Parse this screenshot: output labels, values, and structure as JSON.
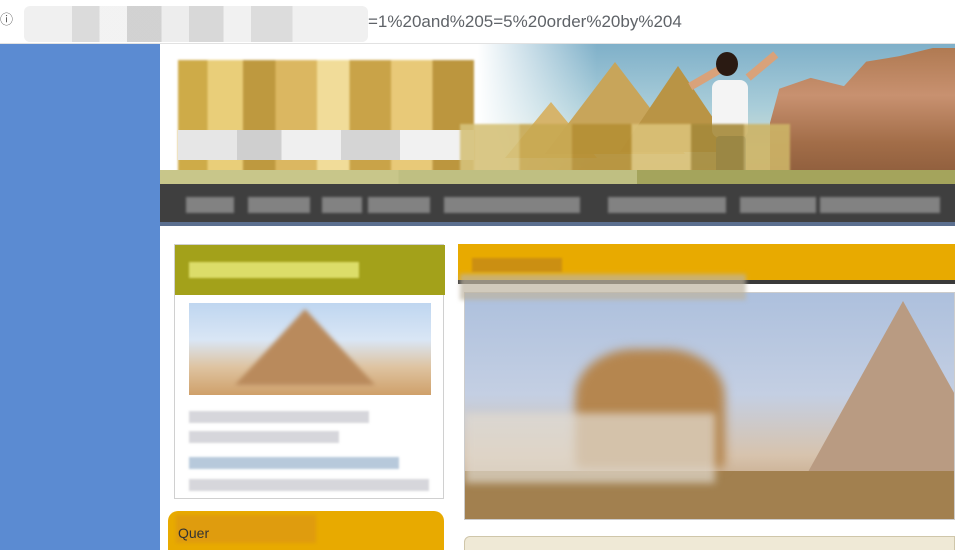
{
  "browser": {
    "url_visible": "=1%20and%205=5%20order%20by%204"
  },
  "icons": {
    "info": "info-icon"
  },
  "query_box": {
    "label": "Quer"
  }
}
